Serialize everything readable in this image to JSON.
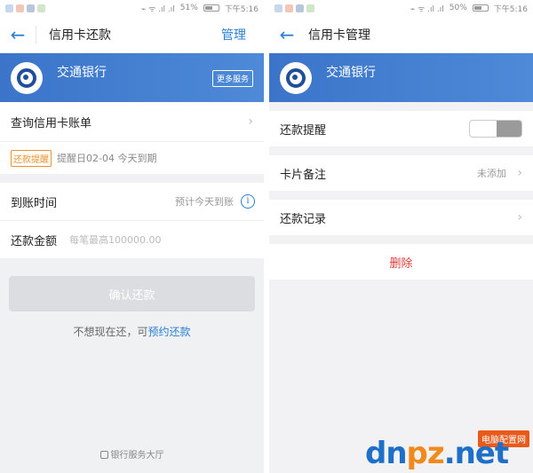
{
  "status_left": {
    "signal_text": "⌁ ᯤ .ıl .ıl",
    "battery_pct": "51%",
    "time": "下午5:16"
  },
  "status_right": {
    "signal_text": "⌁ ᯤ .ıl .ıl",
    "battery_pct": "50%",
    "time": "下午5:16"
  },
  "left": {
    "nav": {
      "back": "←",
      "title": "信用卡还款",
      "action": "管理"
    },
    "bank": {
      "name": "交通银行",
      "more": "更多服务"
    },
    "query_bill": "查询信用卡账单",
    "reminder": {
      "badge": "还款提醒",
      "text": "提醒日02-04 今天到期"
    },
    "arrival": {
      "label": "到账时间",
      "hint": "预计今天到账",
      "info_icon": "i"
    },
    "amount": {
      "label": "还款金额",
      "placeholder": "每笔最高100000.00"
    },
    "confirm": "确认还款",
    "later": {
      "prefix": "不想现在还，可",
      "link": "预约还款"
    },
    "hall": "银行服务大厅"
  },
  "right": {
    "nav": {
      "back": "←",
      "title": "信用卡管理"
    },
    "bank": {
      "name": "交通银行"
    },
    "reminder_label": "还款提醒",
    "reminder_enabled": false,
    "card_note": {
      "label": "卡片备注",
      "value": "未添加"
    },
    "records": "还款记录",
    "delete": "删除"
  },
  "watermark": {
    "logo_a": "dn",
    "logo_b": "pz",
    "logo_c": ".net",
    "tag": "电脑配置网"
  },
  "colors": {
    "accent": "#2a7fd3",
    "bank_bar": "#3b74c9",
    "warn": "#e8932b",
    "danger": "#e03a3a"
  }
}
